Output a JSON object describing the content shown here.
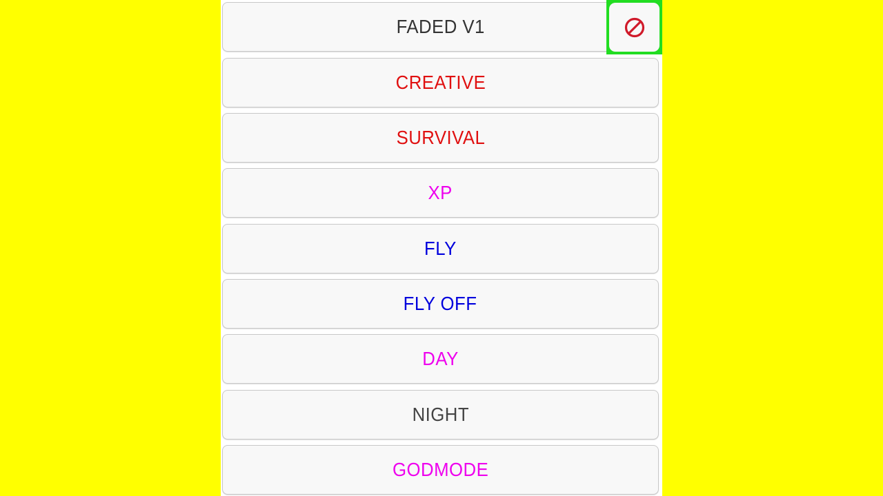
{
  "menu": {
    "title": "FADED V1",
    "title_color": "#333333",
    "close_icon": "prohibited-icon",
    "close_icon_color": "#d01a2a",
    "items": [
      {
        "label": "CREATIVE",
        "color": "#e01010"
      },
      {
        "label": "SURVIVAL",
        "color": "#e01010"
      },
      {
        "label": "XP",
        "color": "#ee00ee"
      },
      {
        "label": "FLY",
        "color": "#0000dd"
      },
      {
        "label": "FLY OFF",
        "color": "#0000dd"
      },
      {
        "label": "DAY",
        "color": "#ee00ee"
      },
      {
        "label": "NIGHT",
        "color": "#444444"
      },
      {
        "label": "GODMODE",
        "color": "#ee00ee"
      }
    ]
  },
  "colors": {
    "background": "#ffff00",
    "close_highlight": "#22dd22"
  }
}
